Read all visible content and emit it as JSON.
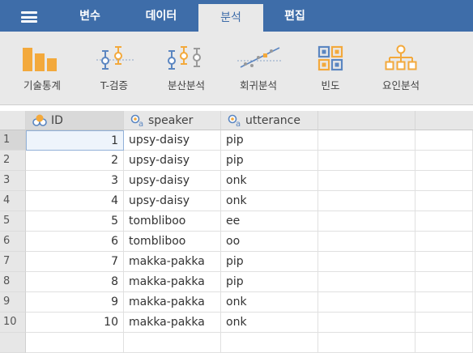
{
  "menu_tabs": [
    "변수",
    "데이터",
    "분석",
    "편집"
  ],
  "active_tab": "분석",
  "ribbon": [
    {
      "label": "기술통계",
      "icon": "descriptives-bar-icon"
    },
    {
      "label": "T-검증",
      "icon": "ttest-icon"
    },
    {
      "label": "분산분석",
      "icon": "anova-icon"
    },
    {
      "label": "회귀분석",
      "icon": "regression-icon"
    },
    {
      "label": "빈도",
      "icon": "frequencies-icon"
    },
    {
      "label": "요인분석",
      "icon": "factor-icon"
    }
  ],
  "colors": {
    "topbar": "#3e6da9",
    "ribbon_bg": "#e9e9e9",
    "icon_orange": "#f3a93c",
    "icon_blue": "#5b86c1"
  },
  "columns": [
    {
      "name": "ID",
      "type_icon": "id-column-icon"
    },
    {
      "name": "speaker",
      "type_icon": "nominal-text-icon"
    },
    {
      "name": "utterance",
      "type_icon": "nominal-text-icon"
    }
  ],
  "row_numbers": [
    "1",
    "2",
    "3",
    "4",
    "5",
    "6",
    "7",
    "8",
    "9",
    "10"
  ],
  "rows": [
    {
      "id": "1",
      "speaker": "upsy-daisy",
      "utterance": "pip"
    },
    {
      "id": "2",
      "speaker": "upsy-daisy",
      "utterance": "pip"
    },
    {
      "id": "3",
      "speaker": "upsy-daisy",
      "utterance": "onk"
    },
    {
      "id": "4",
      "speaker": "upsy-daisy",
      "utterance": "onk"
    },
    {
      "id": "5",
      "speaker": "tombliboo",
      "utterance": "ee"
    },
    {
      "id": "6",
      "speaker": "tombliboo",
      "utterance": "oo"
    },
    {
      "id": "7",
      "speaker": "makka-pakka",
      "utterance": "pip"
    },
    {
      "id": "8",
      "speaker": "makka-pakka",
      "utterance": "pip"
    },
    {
      "id": "9",
      "speaker": "makka-pakka",
      "utterance": "onk"
    },
    {
      "id": "10",
      "speaker": "makka-pakka",
      "utterance": "onk"
    }
  ]
}
